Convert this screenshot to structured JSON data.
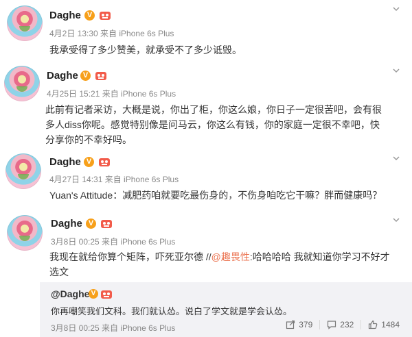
{
  "posts": [
    {
      "author": "Daghe",
      "vip_badge": "V",
      "meta": "4月2日 13:30 来自 iPhone 6s Plus",
      "text": "我承受得了多少赞美，就承受不了多少诋毁。"
    },
    {
      "author": "Daghe",
      "vip_badge": "V",
      "meta": "4月25日 15:21 来自 iPhone 6s Plus",
      "text_lines": [
        "此前有记者采访，大概是说，你出了柜，你这么娘，你日子一定很苦吧，会有很",
        "多人diss你呢。感觉特别像是问马云，你这么有钱，你的家庭一定很不幸吧，快",
        "分享你的不幸好吗。"
      ]
    },
    {
      "author": "Daghe",
      "vip_badge": "V",
      "meta": "4月27日 14:31 来自 iPhone 6s Plus",
      "text": "Yuan's Attitude：减肥药咱就要吃最伤身的，不伤身咱吃它干嘛？胖而健康吗？"
    },
    {
      "author": "Daghe",
      "vip_badge": "V",
      "meta": "3月8日 00:25 来自 iPhone 6s Plus",
      "text_pre": "我现在就给你算个矩阵，吓死亚尔德 //",
      "mention": "@趣畏性",
      "text_post": ":哈哈哈哈 我就知道你学习不好才",
      "text_line2": "选文"
    }
  ],
  "repost": {
    "author": "@Daghe",
    "vip_badge": "V",
    "text": "你再嘲笑我们文科。我们就认怂。说白了学文就是学会认怂。",
    "meta": "3月8日 00:25 来自 iPhone 6s Plus",
    "repost_count": "379",
    "comment_count": "232",
    "like_count": "1484"
  },
  "colors": {
    "accent": "#eb7350",
    "vip": "#f7a01a",
    "repost_bg": "#f2f2f5"
  }
}
